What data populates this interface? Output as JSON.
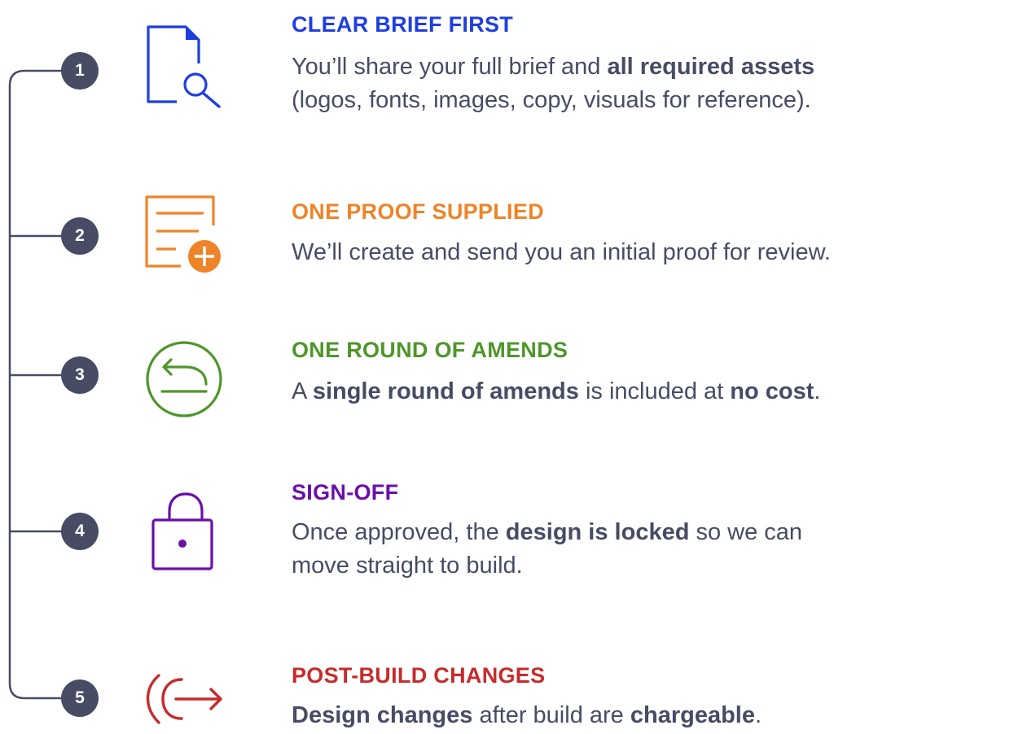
{
  "colors": {
    "line": "#474c64",
    "badge": "#474c64",
    "text": "#474c64",
    "step1": "#1f3ee0",
    "step2": "#ee8428",
    "step3": "#4e962a",
    "step4": "#6a0fa8",
    "step5": "#c72b2b"
  },
  "steps": [
    {
      "number": "1",
      "icon": "document-search-icon",
      "title": "CLEAR BRIEF FIRST",
      "desc": {
        "line1_pre": "You’ll share your full brief and ",
        "line1_bold": "all required assets",
        "line2": "(logos, fonts, images, copy, visuals for reference)."
      }
    },
    {
      "number": "2",
      "icon": "document-add-icon",
      "title": "ONE PROOF SUPPLIED",
      "desc": {
        "line1": "We’ll create and send you an initial proof for review."
      }
    },
    {
      "number": "3",
      "icon": "undo-circle-icon",
      "title": "ONE ROUND OF AMENDS",
      "desc": {
        "t1": "A ",
        "b1": "single round of amends",
        "t2": " is included at ",
        "b2": "no cost",
        "t3": "."
      }
    },
    {
      "number": "4",
      "icon": "padlock-icon",
      "title": "SIGN-OFF",
      "desc": {
        "t1": "Once approved, the ",
        "b1": "design is locked",
        "t2": " so we can",
        "line2": "move straight to build."
      }
    },
    {
      "number": "5",
      "icon": "exit-arrow-icon",
      "title": "POST-BUILD CHANGES",
      "desc": {
        "b1": "Design changes",
        "t1": " after build are ",
        "b2": "chargeable",
        "t2": "."
      }
    }
  ]
}
